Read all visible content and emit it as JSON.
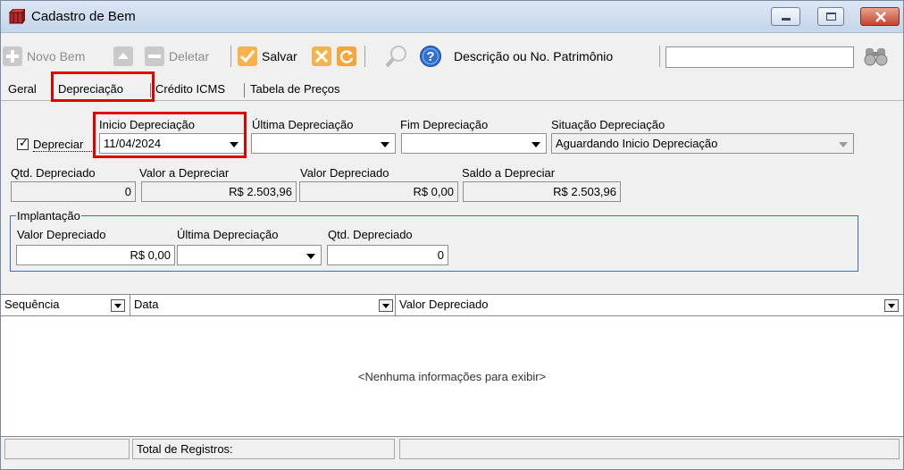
{
  "window": {
    "title": "Cadastro de Bem"
  },
  "toolbar": {
    "novo_label": "Novo Bem",
    "deletar_label": "Deletar",
    "salvar_label": "Salvar",
    "search_label": "Descrição ou No. Patrimônio",
    "search_value": ""
  },
  "tabs": [
    "Geral",
    "Depreciação",
    "Crédito ICMS",
    "Tabela de Preços"
  ],
  "form": {
    "depreciar_label": "Depreciar",
    "depreciar_checked": true,
    "inicio_label": "Inicio Depreciação",
    "inicio_value": "11/04/2024",
    "ultima_label": "Última Depreciação",
    "ultima_value": "",
    "fim_label": "Fim Depreciação",
    "fim_value": "",
    "situacao_label": "Situação Depreciação",
    "situacao_value": "Aguardando Inicio Depreciação",
    "qtd_label": "Qtd. Depreciado",
    "qtd_value": "0",
    "valor_a_dep_label": "Valor a Depreciar",
    "valor_a_dep_value": "R$ 2.503,96",
    "valor_dep_label": "Valor Depreciado",
    "valor_dep_value": "R$ 0,00",
    "saldo_label": "Saldo a Depreciar",
    "saldo_value": "R$ 2.503,96"
  },
  "implantacao": {
    "title": "Implantação",
    "valor_dep_label": "Valor Depreciado",
    "valor_dep_value": "R$ 0,00",
    "ultima_label": "Última Depreciação",
    "ultima_value": "",
    "qtd_label": "Qtd. Depreciado",
    "qtd_value": "0"
  },
  "grid": {
    "columns": [
      "Sequência",
      "Data",
      "Valor Depreciado"
    ],
    "empty_message": "<Nenhuma informações para exibir>"
  },
  "footer": {
    "total_label": "Total de Registros:",
    "total_value": ""
  },
  "colors": {
    "highlight": "#e00000",
    "group_border": "#3f6db5"
  },
  "icons": [
    "app-icon",
    "add-icon",
    "up-arrow-icon",
    "minus-icon",
    "check-icon",
    "cancel-icon",
    "refresh-icon",
    "magnifier-icon",
    "help-icon",
    "binoculars-icon"
  ]
}
